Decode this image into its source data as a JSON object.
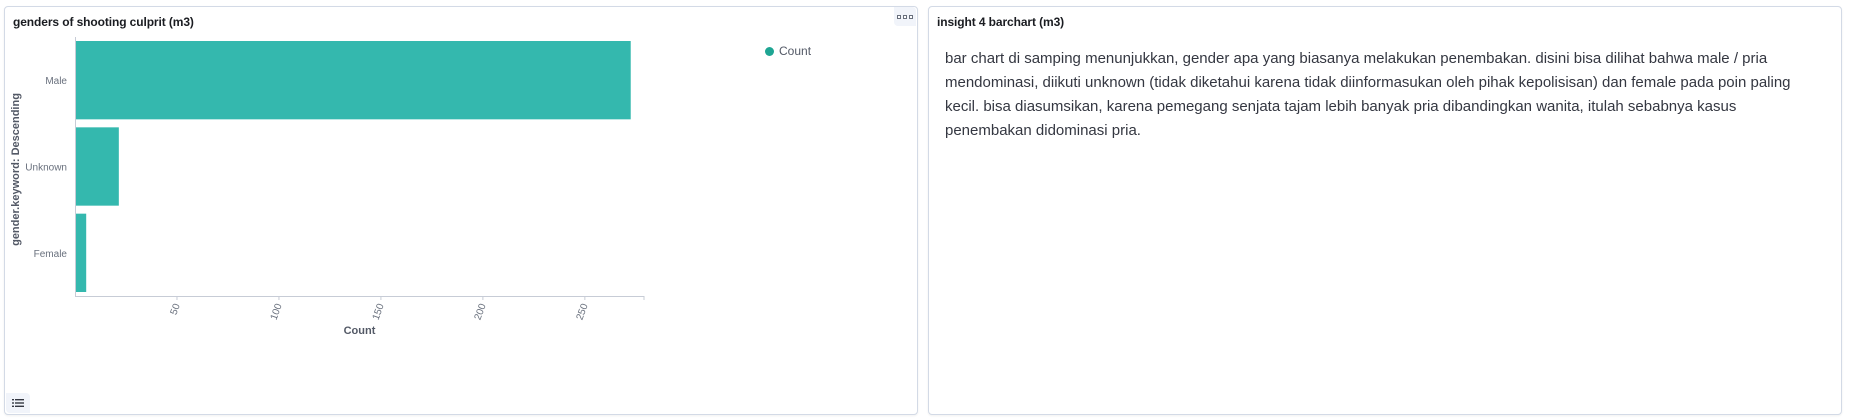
{
  "left_panel": {
    "title": "genders of shooting culprit (m3)",
    "options_icon": "ellipsis-icon",
    "legend_toggle_icon": "list-icon"
  },
  "right_panel": {
    "title": "insight 4 barchart (m3)",
    "text": "bar chart di samping menunjukkan, gender apa yang biasanya melakukan penembakan. disini bisa dilihat bahwa male / pria mendominasi, diikuti unknown (tidak diketahui karena tidak diinformasukan oleh pihak kepolisisan) dan female pada poin paling kecil. bisa diasumsikan, karena pemegang senjata tajam lebih banyak pria dibandingkan wanita, itulah sebabnya kasus penembakan didominasi pria."
  },
  "colors": {
    "bar": "#34b8ae",
    "legend_dot": "#1ea593",
    "axis": "#c7ccd6",
    "tick_text": "#69707d",
    "axis_title": "#535966"
  },
  "chart_data": {
    "type": "bar",
    "orientation": "horizontal",
    "categories": [
      "Male",
      "Unknown",
      "Female"
    ],
    "series": [
      {
        "name": "Count",
        "values": [
          272,
          21,
          5
        ]
      }
    ],
    "xlabel": "Count",
    "ylabel": "gender.keyword: Descending",
    "xticks": [
      50,
      100,
      150,
      200,
      250
    ],
    "xlim": [
      0,
      279
    ],
    "legend": "top-right",
    "grid": false
  }
}
